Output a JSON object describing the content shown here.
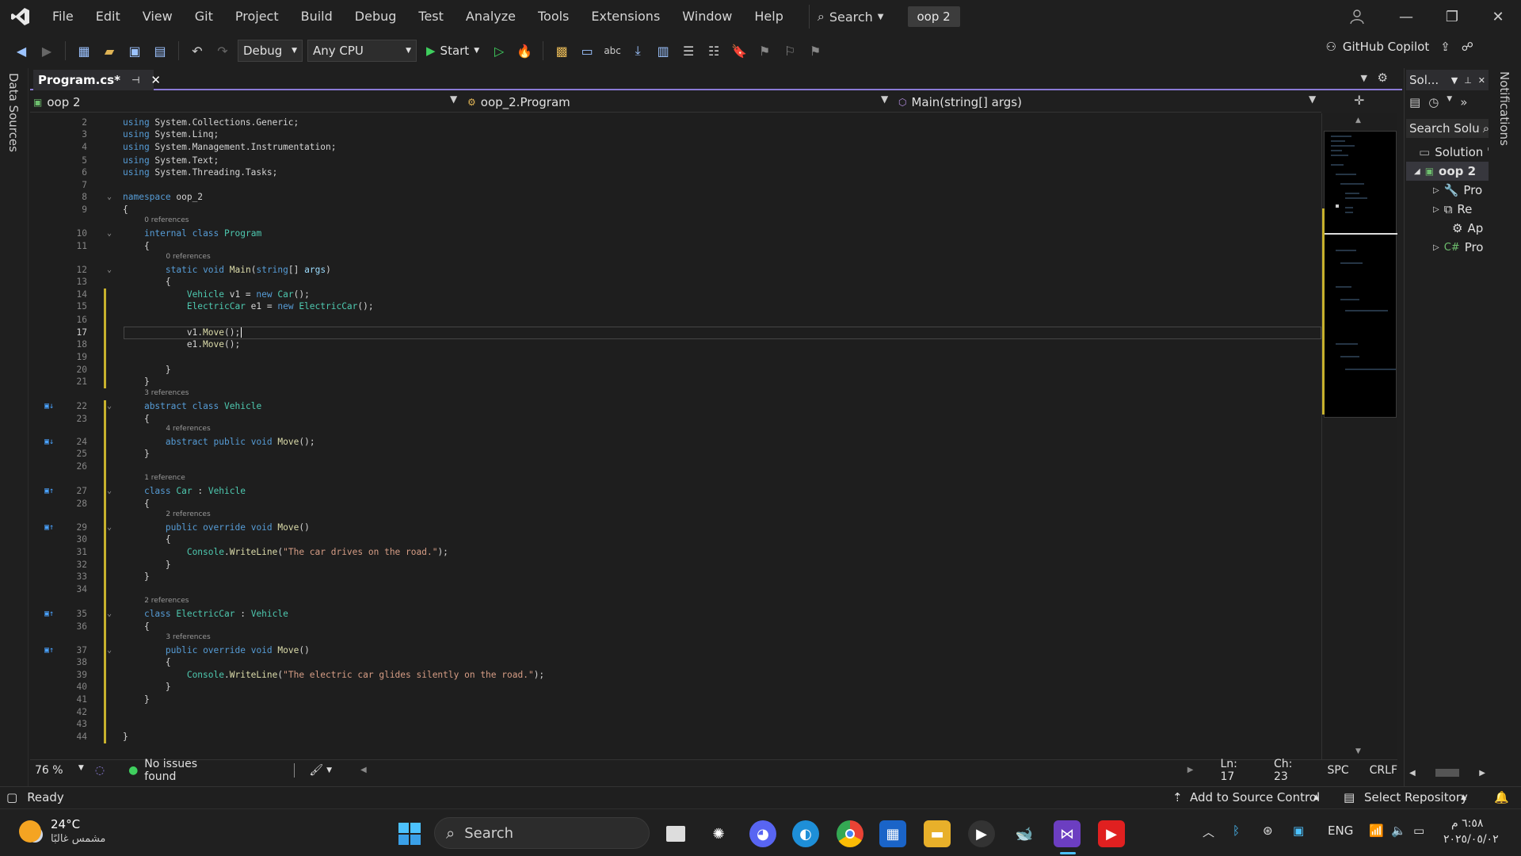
{
  "menubar": {
    "items": [
      "File",
      "Edit",
      "View",
      "Git",
      "Project",
      "Build",
      "Debug",
      "Test",
      "Analyze",
      "Tools",
      "Extensions",
      "Window",
      "Help"
    ],
    "search_label": "Search",
    "project_badge": "oop 2"
  },
  "toolbar": {
    "config": "Debug",
    "platform": "Any CPU",
    "start_label": "Start",
    "copilot_label": "GitHub Copilot"
  },
  "left_strip": {
    "label": "Data Sources"
  },
  "right_strip": {
    "label": "Notifications"
  },
  "tab": {
    "title": "Program.cs*"
  },
  "navbar": {
    "project": "oop 2",
    "type": "oop_2.Program",
    "member": "Main(string[] args)"
  },
  "editor": {
    "lines": [
      {
        "n": "2",
        "code": "using System.Collections.Generic;"
      },
      {
        "n": "3",
        "code": "using System.Linq;"
      },
      {
        "n": "4",
        "code": "using System.Management.Instrumentation;"
      },
      {
        "n": "5",
        "code": "using System.Text;"
      },
      {
        "n": "6",
        "code": "using System.Threading.Tasks;"
      },
      {
        "n": "7",
        "code": ""
      },
      {
        "n": "8",
        "code": "namespace oop_2"
      },
      {
        "n": "9",
        "code": "{"
      },
      {
        "n": "10",
        "code": "    internal class Program"
      },
      {
        "n": "11",
        "code": "    {"
      },
      {
        "n": "12",
        "code": "        static void Main(string[] args)"
      },
      {
        "n": "13",
        "code": "        {"
      },
      {
        "n": "14",
        "code": "            Vehicle v1 = new Car();"
      },
      {
        "n": "15",
        "code": "            ElectricCar e1 = new ElectricCar();"
      },
      {
        "n": "16",
        "code": ""
      },
      {
        "n": "17",
        "code": "            v1.Move();"
      },
      {
        "n": "18",
        "code": "            e1.Move();"
      },
      {
        "n": "19",
        "code": ""
      },
      {
        "n": "20",
        "code": "        }"
      },
      {
        "n": "21",
        "code": "    }"
      },
      {
        "n": "22",
        "code": "    abstract class Vehicle"
      },
      {
        "n": "23",
        "code": "    {"
      },
      {
        "n": "24",
        "code": "        abstract public void Move();"
      },
      {
        "n": "25",
        "code": "    }"
      },
      {
        "n": "26",
        "code": ""
      },
      {
        "n": "27",
        "code": "    class Car : Vehicle"
      },
      {
        "n": "28",
        "code": "    {"
      },
      {
        "n": "29",
        "code": "        public override void Move()"
      },
      {
        "n": "30",
        "code": "        {"
      },
      {
        "n": "31",
        "code": "            Console.WriteLine(\"The car drives on the road.\");"
      },
      {
        "n": "32",
        "code": "        }"
      },
      {
        "n": "33",
        "code": "    }"
      },
      {
        "n": "34",
        "code": ""
      },
      {
        "n": "35",
        "code": "    class ElectricCar : Vehicle"
      },
      {
        "n": "36",
        "code": "    {"
      },
      {
        "n": "37",
        "code": "        public override void Move()"
      },
      {
        "n": "38",
        "code": "        {"
      },
      {
        "n": "39",
        "code": "            Console.WriteLine(\"The electric car glides silently on the road.\");"
      },
      {
        "n": "40",
        "code": "        }"
      },
      {
        "n": "41",
        "code": "    }"
      },
      {
        "n": "42",
        "code": ""
      },
      {
        "n": "43",
        "code": ""
      },
      {
        "n": "44",
        "code": "}"
      }
    ],
    "codelens": {
      "program": "0 references",
      "main": "0 references",
      "vehicle": "3 references",
      "vehicle_move": "4 references",
      "car": "1 reference",
      "car_move": "2 references",
      "electric": "2 references",
      "electric_move": "3 references"
    }
  },
  "solution": {
    "title": "Sol...",
    "search": "Search Solu",
    "items": [
      "Solution '",
      "oop 2",
      "Pro",
      "Re",
      "Ap",
      "Pro"
    ]
  },
  "editor_status": {
    "zoom": "76 %",
    "issues": "No issues found",
    "ln": "Ln: 17",
    "ch": "Ch: 23",
    "spc": "SPC",
    "crlf": "CRLF"
  },
  "statusbar": {
    "ready": "Ready",
    "source_control": "Add to Source Control",
    "repository": "Select Repository"
  },
  "taskbar": {
    "temp": "24°C",
    "weather": "مشمس غالبًا",
    "search": "Search",
    "lang": "ENG",
    "time": "٦:٥٨ م",
    "date": "٢٠٢٥/٠٥/٠٢"
  }
}
